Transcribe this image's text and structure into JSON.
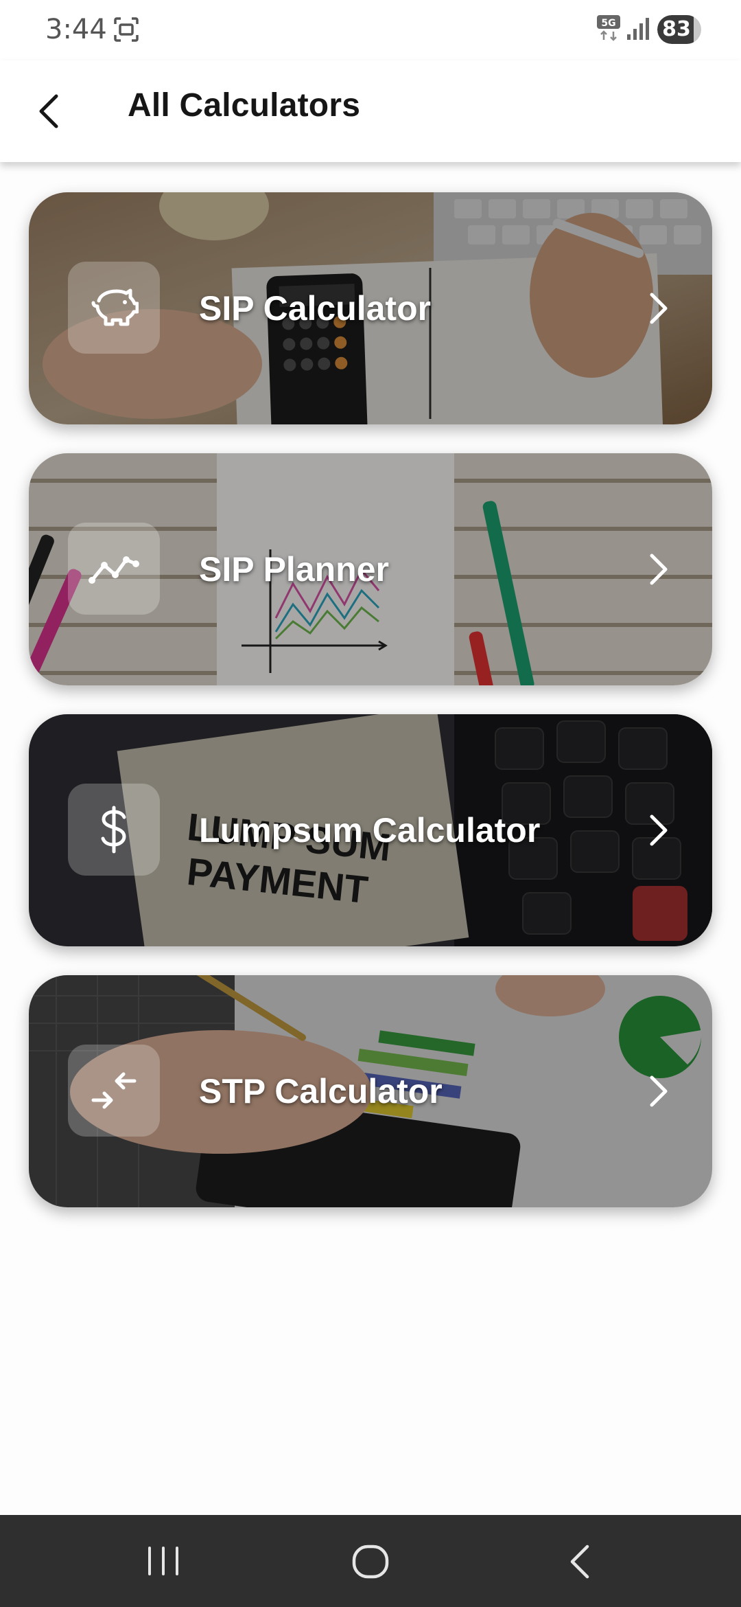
{
  "status_bar": {
    "time": "3:44",
    "network": "5G",
    "battery": "83",
    "battery_level_percent": 83
  },
  "header": {
    "title": "All Calculators",
    "back_icon": "back-arrow-icon"
  },
  "calculators": [
    {
      "label": "SIP Calculator",
      "icon": "piggy-bank-icon",
      "chevron": "chevron-right-icon"
    },
    {
      "label": "SIP Planner",
      "icon": "trend-line-icon",
      "chevron": "chevron-right-icon"
    },
    {
      "label": "Lumpsum Calculator",
      "icon": "dollar-icon",
      "chevron": "chevron-right-icon"
    },
    {
      "label": "STP Calculator",
      "icon": "transfer-arrows-icon",
      "chevron": "chevron-right-icon"
    }
  ],
  "nav_bar": {
    "recents_icon": "recents-icon",
    "home_icon": "home-icon",
    "back_icon": "back-icon"
  },
  "colors": {
    "app_bar_bg": "#ffffff",
    "page_bg": "#fdfdfd",
    "nav_bar_bg": "#2f2f2f",
    "card_text": "#ffffff"
  }
}
